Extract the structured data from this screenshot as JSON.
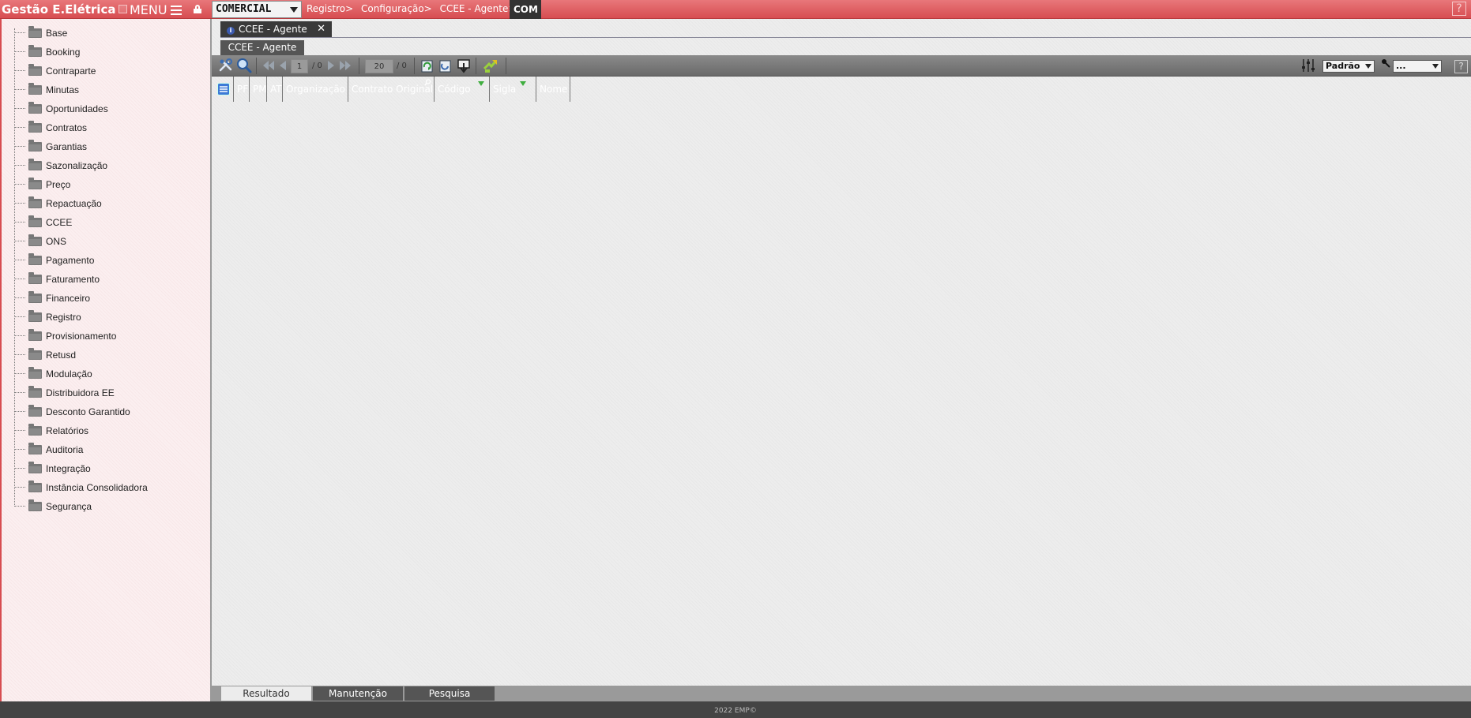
{
  "app": {
    "title": "Gestão E.Elétrica",
    "menu_label": "MENU"
  },
  "module_select": {
    "value": "COMERCIAL"
  },
  "breadcrumb": {
    "items": [
      "Registro>",
      "Configuração>",
      "CCEE - Agente>"
    ],
    "current": "COM"
  },
  "help_top": "?",
  "sidebar": {
    "items": [
      {
        "label": "Base"
      },
      {
        "label": "Booking"
      },
      {
        "label": "Contraparte"
      },
      {
        "label": "Minutas"
      },
      {
        "label": "Oportunidades"
      },
      {
        "label": "Contratos"
      },
      {
        "label": "Garantias"
      },
      {
        "label": "Sazonalização"
      },
      {
        "label": "Preço"
      },
      {
        "label": "Repactuação"
      },
      {
        "label": "CCEE"
      },
      {
        "label": "ONS"
      },
      {
        "label": "Pagamento"
      },
      {
        "label": "Faturamento"
      },
      {
        "label": "Financeiro"
      },
      {
        "label": "Registro"
      },
      {
        "label": "Provisionamento"
      },
      {
        "label": "Retusd"
      },
      {
        "label": "Modulação"
      },
      {
        "label": "Distribuidora EE"
      },
      {
        "label": "Desconto Garantido"
      },
      {
        "label": "Relatórios"
      },
      {
        "label": "Auditoria"
      },
      {
        "label": "Integração"
      },
      {
        "label": "Instância Consolidadora"
      },
      {
        "label": "Segurança"
      }
    ]
  },
  "document_tab": {
    "label": "CCEE - Agente",
    "close": "✕",
    "info": "i"
  },
  "subtab": {
    "label": "CCEE - Agente"
  },
  "toolbar": {
    "page_current": "1",
    "page_total": "/ 0",
    "page_size": "20",
    "record_total": "/ 0",
    "layout_select": "Padrão",
    "filter_select": "...",
    "help": "?"
  },
  "grid": {
    "columns": [
      {
        "label": ""
      },
      {
        "label": "PF"
      },
      {
        "label": "PM"
      },
      {
        "label": "AT"
      },
      {
        "label": "Organização"
      },
      {
        "label": "Contrato Original"
      },
      {
        "label": "Código"
      },
      {
        "label": "Sigla"
      },
      {
        "label": "Nome"
      }
    ]
  },
  "bottom_tabs": [
    {
      "label": "Resultado"
    },
    {
      "label": "Manutenção"
    },
    {
      "label": "Pesquisa"
    }
  ],
  "footer": {
    "text": "2022 EMP©"
  },
  "colors": {
    "brand": "#d74d51",
    "toolbar": "#777777",
    "grid_header": "#3a3a3a"
  }
}
